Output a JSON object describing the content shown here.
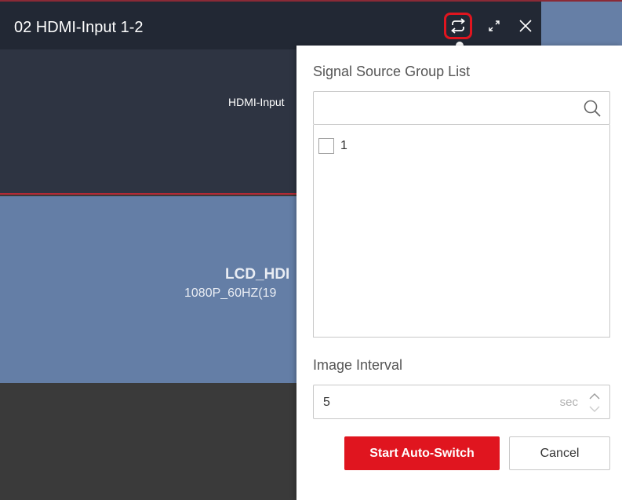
{
  "window": {
    "title": "02  HDMI-Input 1-2",
    "top_source_label": "HDMI-Input",
    "mid_source_name": "LCD_HDI",
    "mid_source_resolution": "1080P_60HZ(19"
  },
  "icons": {
    "auto_switch": "loop-arrows-icon",
    "expand": "expand-icon",
    "close": "close-icon",
    "search": "search-icon",
    "stepper": "chevron-up-down-icon"
  },
  "panel": {
    "group_list_title": "Signal Source Group List",
    "search": {
      "value": "",
      "placeholder": ""
    },
    "groups": [
      {
        "label": "1",
        "checked": false
      }
    ],
    "interval_title": "Image Interval",
    "interval_value": "5",
    "interval_unit": "sec",
    "start_button": "Start Auto-Switch",
    "cancel_button": "Cancel"
  },
  "colors": {
    "accent": "#e0151f",
    "titlebar": "#222834",
    "window_blue": "#647ea6",
    "window_dark": "#2e3442"
  }
}
